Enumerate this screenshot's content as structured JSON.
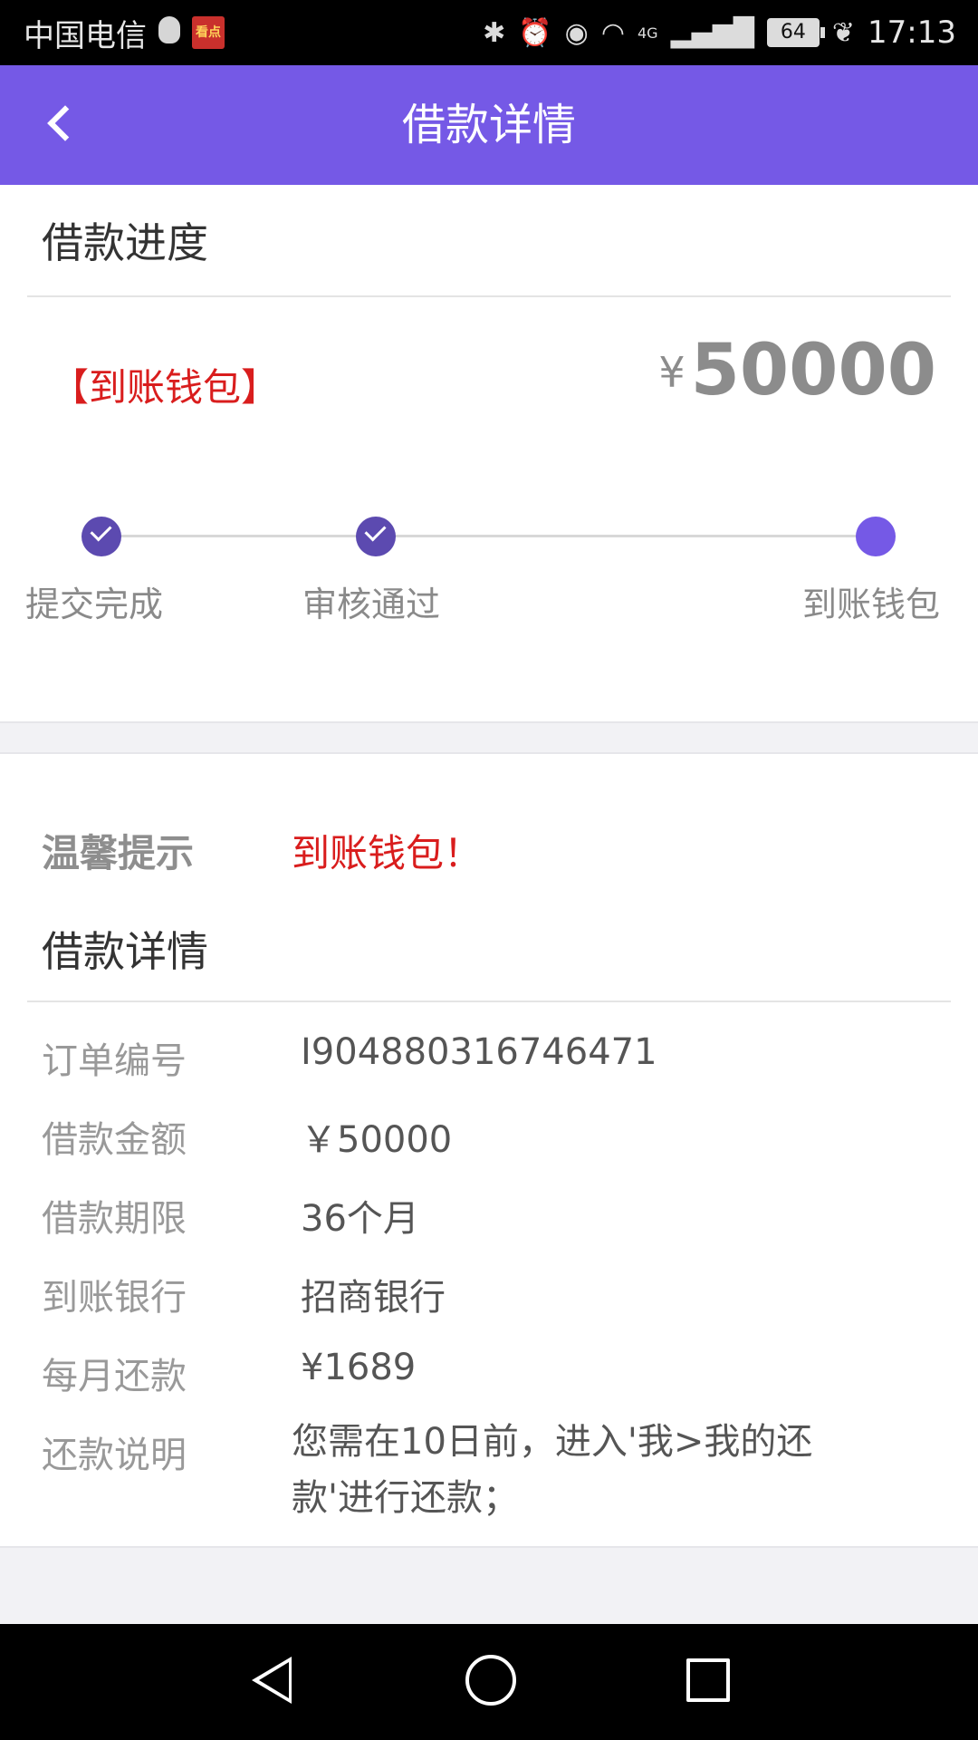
{
  "status_bar": {
    "carrier": "中国电信",
    "network": "4G",
    "battery": "64",
    "time": "17:13",
    "icons": [
      "qq-icon",
      "kandian-app-icon",
      "bluetooth-icon",
      "alarm-icon",
      "eye-icon",
      "wifi-icon",
      "signal-icon",
      "battery-icon",
      "leaf-icon"
    ]
  },
  "header": {
    "title": "借款详情",
    "back_icon": "chevron-left-icon"
  },
  "progress": {
    "section_title": "借款进度",
    "wallet_tag": "【到账钱包】",
    "currency": "¥",
    "amount": "50000",
    "steps": [
      {
        "label": "提交完成",
        "state": "done"
      },
      {
        "label": "审核通过",
        "state": "done"
      },
      {
        "label": "到账钱包",
        "state": "current"
      }
    ],
    "accent_color": "#7559e6"
  },
  "tip": {
    "label": "温馨提示",
    "text": "到账钱包！"
  },
  "details": {
    "section_title": "借款详情",
    "rows": [
      {
        "label": "订单编号",
        "value": "I904880316746471"
      },
      {
        "label": "借款金额",
        "value": "￥50000"
      },
      {
        "label": "借款期限",
        "value": "36个月"
      },
      {
        "label": "到账银行",
        "value": "招商银行"
      },
      {
        "label": "每月还款",
        "value": "¥1689"
      },
      {
        "label": "还款说明",
        "value": "您需在10日前，进入'我>我的还款'进行还款；"
      }
    ]
  },
  "nav": {
    "icons": [
      "nav-back-icon",
      "nav-home-icon",
      "nav-recent-apps-icon"
    ]
  }
}
